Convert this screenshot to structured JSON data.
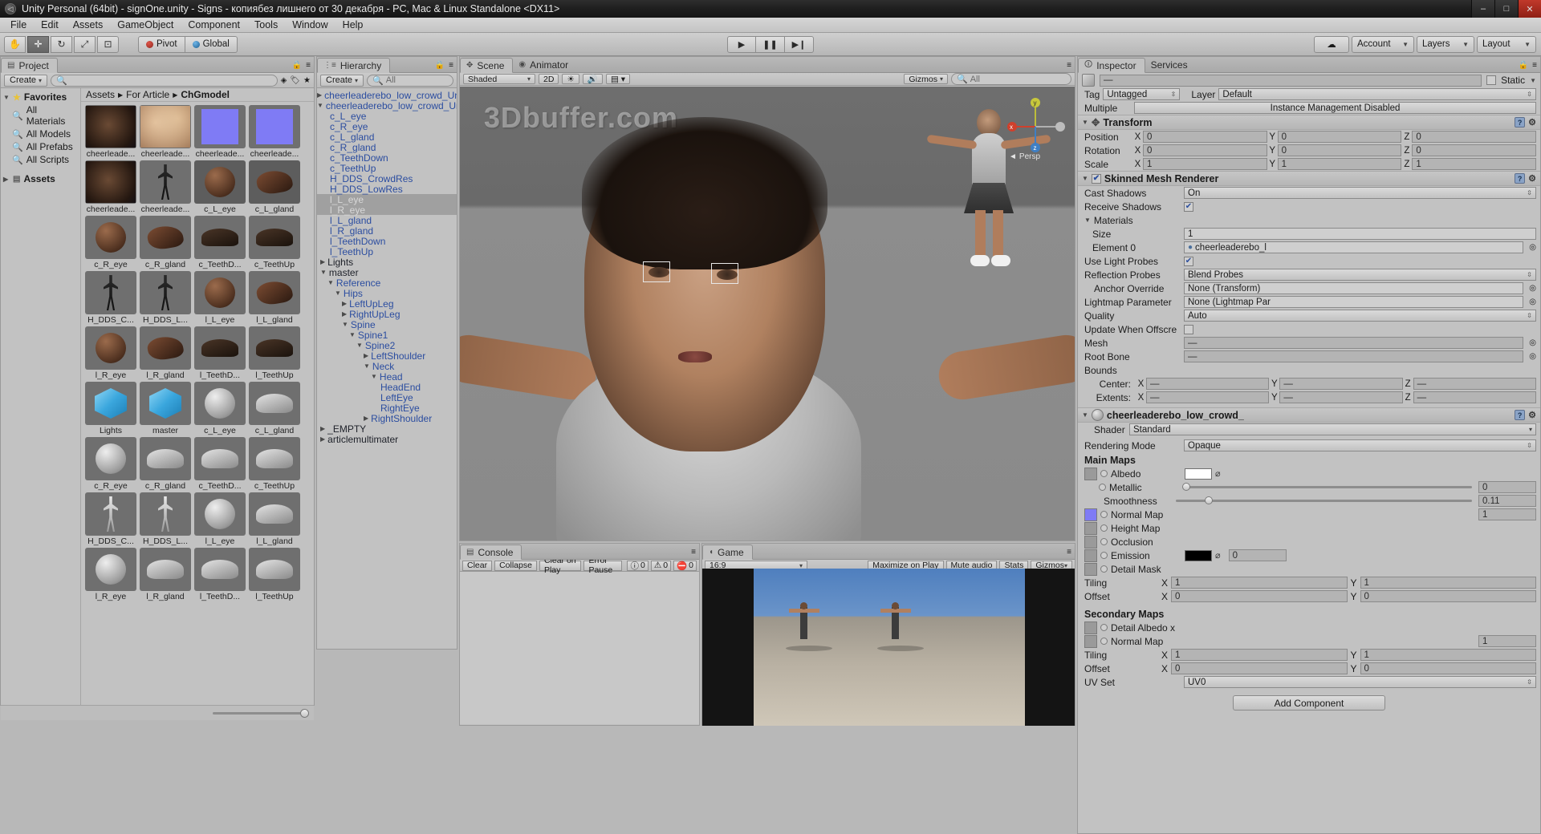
{
  "window": {
    "title": "Unity Personal (64bit) - signOne.unity - Signs - копиябез лишнего от 30 декабря - PC, Mac & Linux Standalone <DX11>",
    "minimize": "–",
    "maximize": "□",
    "close": "✕"
  },
  "menu": [
    "File",
    "Edit",
    "Assets",
    "GameObject",
    "Component",
    "Tools",
    "Window",
    "Help"
  ],
  "toolbar": {
    "tools": [
      "hand-tool",
      "move-tool",
      "rotate-tool",
      "scale-tool",
      "rect-tool"
    ],
    "tool_glyphs": [
      "✋",
      "✛",
      "↻",
      "⤢",
      "⊡"
    ],
    "pivot": "Pivot",
    "global": "Global",
    "play": "▶",
    "pause": "❚❚",
    "step": "▶❙",
    "cloud": "☁",
    "account": "Account",
    "layers": "Layers",
    "layout": "Layout"
  },
  "project": {
    "tab": "Project",
    "create": "Create",
    "search_placeholder": "",
    "favorites_label": "Favorites",
    "favorites": [
      "All Materials",
      "All Models",
      "All Prefabs",
      "All Scripts"
    ],
    "assets_label": "Assets",
    "breadcrumb": [
      "Assets",
      "For Article",
      "ChGmodel"
    ],
    "rows": [
      [
        {
          "name": "cheerleade...",
          "kind": "tex-dark",
          "sel": false
        },
        {
          "name": "cheerleade...",
          "kind": "tex-face",
          "sel": false
        },
        {
          "name": "cheerleade...",
          "kind": "normal",
          "sel": false
        },
        {
          "name": "cheerleade...",
          "kind": "normal",
          "sel": false
        }
      ],
      [
        {
          "name": "cheerleade...",
          "kind": "tex-dark",
          "sel": false
        },
        {
          "name": "cheerleade...",
          "kind": "model-fig",
          "sel": false
        },
        {
          "name": "c_L_eye",
          "kind": "sphere-brown",
          "sel": true
        },
        {
          "name": "c_L_gland",
          "kind": "mesh-brown",
          "sel": true
        }
      ],
      [
        {
          "name": "c_R_eye",
          "kind": "sphere-brown",
          "sel": false
        },
        {
          "name": "c_R_gland",
          "kind": "mesh-brown",
          "sel": false
        },
        {
          "name": "c_TeethD...",
          "kind": "mesh-dark",
          "sel": false
        },
        {
          "name": "c_TeethUp",
          "kind": "mesh-dark",
          "sel": false
        }
      ],
      [
        {
          "name": "H_DDS_C...",
          "kind": "model-fig",
          "sel": false
        },
        {
          "name": "H_DDS_L...",
          "kind": "model-fig",
          "sel": false
        },
        {
          "name": "l_L_eye",
          "kind": "sphere-brown",
          "sel": false
        },
        {
          "name": "l_L_gland",
          "kind": "mesh-brown",
          "sel": false
        }
      ],
      [
        {
          "name": "l_R_eye",
          "kind": "sphere-brown",
          "sel": false
        },
        {
          "name": "l_R_gland",
          "kind": "mesh-brown",
          "sel": false
        },
        {
          "name": "l_TeethD...",
          "kind": "mesh-dark",
          "sel": false
        },
        {
          "name": "l_TeethUp",
          "kind": "mesh-dark",
          "sel": false
        }
      ],
      [
        {
          "name": "Lights",
          "kind": "cube-blue",
          "sel": false
        },
        {
          "name": "master",
          "kind": "cube-blue",
          "sel": false
        },
        {
          "name": "c_L_eye",
          "kind": "sphere-grey",
          "sel": false
        },
        {
          "name": "c_L_gland",
          "kind": "mesh-grey",
          "sel": false
        }
      ],
      [
        {
          "name": "c_R_eye",
          "kind": "sphere-grey",
          "sel": false
        },
        {
          "name": "c_R_gland",
          "kind": "mesh-grey",
          "sel": false
        },
        {
          "name": "c_TeethD...",
          "kind": "mesh-grey",
          "sel": false
        },
        {
          "name": "c_TeethUp",
          "kind": "mesh-grey",
          "sel": false
        }
      ],
      [
        {
          "name": "H_DDS_C...",
          "kind": "model-grey",
          "sel": false
        },
        {
          "name": "H_DDS_L...",
          "kind": "model-grey",
          "sel": false
        },
        {
          "name": "l_L_eye",
          "kind": "sphere-grey",
          "sel": false
        },
        {
          "name": "l_L_gland",
          "kind": "mesh-grey",
          "sel": false
        }
      ],
      [
        {
          "name": "l_R_eye",
          "kind": "sphere-grey",
          "sel": false
        },
        {
          "name": "l_R_gland",
          "kind": "mesh-grey",
          "sel": false
        },
        {
          "name": "l_TeethD...",
          "kind": "mesh-grey",
          "sel": false
        },
        {
          "name": "l_TeethUp",
          "kind": "mesh-grey",
          "sel": false
        }
      ]
    ]
  },
  "hierarchy": {
    "tab": "Hierarchy",
    "create": "Create",
    "search_placeholder": "All",
    "items": [
      {
        "label": "cheerleaderebo_low_crowd_Unity",
        "depth": 0,
        "arrow": "right",
        "style": "prefab",
        "sel": false
      },
      {
        "label": "cheerleaderebo_low_crowd_Unity",
        "depth": 0,
        "arrow": "down",
        "style": "prefab",
        "sel": false
      },
      {
        "label": "c_L_eye",
        "depth": 1,
        "arrow": "none",
        "style": "prefab",
        "sel": false
      },
      {
        "label": "c_R_eye",
        "depth": 1,
        "arrow": "none",
        "style": "prefab",
        "sel": false
      },
      {
        "label": "c_L_gland",
        "depth": 1,
        "arrow": "none",
        "style": "prefab",
        "sel": false
      },
      {
        "label": "c_R_gland",
        "depth": 1,
        "arrow": "none",
        "style": "prefab",
        "sel": false
      },
      {
        "label": "c_TeethDown",
        "depth": 1,
        "arrow": "none",
        "style": "prefab",
        "sel": false
      },
      {
        "label": "c_TeethUp",
        "depth": 1,
        "arrow": "none",
        "style": "prefab",
        "sel": false
      },
      {
        "label": "H_DDS_CrowdRes",
        "depth": 1,
        "arrow": "none",
        "style": "prefab",
        "sel": false
      },
      {
        "label": "H_DDS_LowRes",
        "depth": 1,
        "arrow": "none",
        "style": "prefab",
        "sel": false
      },
      {
        "label": "l_L_eye",
        "depth": 1,
        "arrow": "none",
        "style": "prefab",
        "sel": true
      },
      {
        "label": "l_R_eye",
        "depth": 1,
        "arrow": "none",
        "style": "prefab",
        "sel": true
      },
      {
        "label": "l_L_gland",
        "depth": 1,
        "arrow": "none",
        "style": "prefab",
        "sel": false
      },
      {
        "label": "l_R_gland",
        "depth": 1,
        "arrow": "none",
        "style": "prefab",
        "sel": false
      },
      {
        "label": "l_TeethDown",
        "depth": 1,
        "arrow": "none",
        "style": "prefab",
        "sel": false
      },
      {
        "label": "l_TeethUp",
        "depth": 1,
        "arrow": "none",
        "style": "prefab",
        "sel": false
      },
      {
        "label": "Lights",
        "depth": 0,
        "arrow": "right",
        "style": "plain",
        "sel": false
      },
      {
        "label": "master",
        "depth": 0,
        "arrow": "down",
        "style": "plain",
        "sel": false
      },
      {
        "label": "Reference",
        "depth": 1,
        "arrow": "down",
        "style": "prefab",
        "sel": false
      },
      {
        "label": "Hips",
        "depth": 2,
        "arrow": "down",
        "style": "prefab",
        "sel": false
      },
      {
        "label": "LeftUpLeg",
        "depth": 3,
        "arrow": "right",
        "style": "prefab",
        "sel": false
      },
      {
        "label": "RightUpLeg",
        "depth": 3,
        "arrow": "right",
        "style": "prefab",
        "sel": false
      },
      {
        "label": "Spine",
        "depth": 3,
        "arrow": "down",
        "style": "prefab",
        "sel": false
      },
      {
        "label": "Spine1",
        "depth": 4,
        "arrow": "down",
        "style": "prefab",
        "sel": false
      },
      {
        "label": "Spine2",
        "depth": 5,
        "arrow": "down",
        "style": "prefab",
        "sel": false
      },
      {
        "label": "LeftShoulder",
        "depth": 6,
        "arrow": "right",
        "style": "prefab",
        "sel": false
      },
      {
        "label": "Neck",
        "depth": 6,
        "arrow": "down",
        "style": "prefab",
        "sel": false
      },
      {
        "label": "Head",
        "depth": 7,
        "arrow": "down",
        "style": "prefab",
        "sel": false
      },
      {
        "label": "HeadEnd",
        "depth": 8,
        "arrow": "none",
        "style": "prefab",
        "sel": false
      },
      {
        "label": "LeftEye",
        "depth": 8,
        "arrow": "none",
        "style": "prefab",
        "sel": false
      },
      {
        "label": "RightEye",
        "depth": 8,
        "arrow": "none",
        "style": "prefab",
        "sel": false
      },
      {
        "label": "RightShoulder",
        "depth": 6,
        "arrow": "right",
        "style": "prefab",
        "sel": false
      },
      {
        "label": "_EMPTY",
        "depth": 0,
        "arrow": "right",
        "style": "plain",
        "sel": false
      },
      {
        "label": "articlemultimater",
        "depth": 0,
        "arrow": "right",
        "style": "plain",
        "sel": false
      }
    ]
  },
  "scene": {
    "tab": "Scene",
    "animator_tab": "Animator",
    "shading": "Shaded",
    "mode2d": "2D",
    "gizmos": "Gizmos",
    "search_placeholder": "All",
    "watermark": "3Dbuffer.com",
    "persp_label": "Persp",
    "axis_x": "x",
    "axis_y": "y",
    "axis_z": "z"
  },
  "console": {
    "tab": "Console",
    "buttons": [
      "Clear",
      "Collapse",
      "Clear on Play",
      "Error Pause"
    ],
    "counts": {
      "info": "0",
      "warning": "0",
      "error": "0"
    }
  },
  "game": {
    "tab": "Game",
    "aspect": "16:9",
    "maximize": "Maximize on Play",
    "mute": "Mute audio",
    "stats": "Stats",
    "gizmos": "Gizmos"
  },
  "inspector": {
    "tab": "Inspector",
    "services_tab": "Services",
    "object_name": "—",
    "static_label": "Static",
    "tag_label": "Tag",
    "tag_value": "Untagged",
    "layer_label": "Layer",
    "layer_value": "Default",
    "multiple_label": "Multiple",
    "instance_mgmt": "Instance Management Disabled",
    "transform": {
      "title": "Transform",
      "position_label": "Position",
      "position": {
        "x": "0",
        "y": "0",
        "z": "0"
      },
      "rotation_label": "Rotation",
      "rotation": {
        "x": "0",
        "y": "0",
        "z": "0"
      },
      "scale_label": "Scale",
      "scale": {
        "x": "1",
        "y": "1",
        "z": "1"
      }
    },
    "smr": {
      "title": "Skinned Mesh Renderer",
      "cast_shadows_label": "Cast Shadows",
      "cast_shadows": "On",
      "receive_shadows_label": "Receive Shadows",
      "receive_shadows": true,
      "materials_label": "Materials",
      "size_label": "Size",
      "size": "1",
      "element0_label": "Element 0",
      "element0": "cheerleaderebo_l",
      "light_probes_label": "Use Light Probes",
      "light_probes": true,
      "refl_probes_label": "Reflection Probes",
      "refl_probes": "Blend Probes",
      "anchor_label": "Anchor Override",
      "anchor": "None (Transform)",
      "lightmap_label": "Lightmap Parameter",
      "lightmap": "None (Lightmap Par",
      "quality_label": "Quality",
      "quality": "Auto",
      "update_offscreen_label": "Update When Offscre",
      "update_offscreen": false,
      "mesh_label": "Mesh",
      "mesh": "—",
      "root_bone_label": "Root Bone",
      "root_bone": "—",
      "bounds_label": "Bounds",
      "center_label": "Center:",
      "center": {
        "x": "—",
        "y": "—",
        "z": "—"
      },
      "extents_label": "Extents:",
      "extents": {
        "x": "—",
        "y": "—",
        "z": "—"
      }
    },
    "material": {
      "title": "cheerleaderebo_low_crowd_",
      "shader_label": "Shader",
      "shader": "Standard",
      "rendering_mode_label": "Rendering Mode",
      "rendering_mode": "Opaque",
      "main_maps": "Main Maps",
      "albedo_label": "Albedo",
      "albedo_color": "#ffffff",
      "metallic_label": "Metallic",
      "metallic": "0",
      "metallic_pct": 0,
      "smoothness_label": "Smoothness",
      "smoothness": "0.11",
      "smoothness_pct": 11,
      "normal_map_label": "Normal Map",
      "normal_map": "1",
      "height_map_label": "Height Map",
      "occlusion_label": "Occlusion",
      "emission_label": "Emission",
      "emission_color": "#000000",
      "emission": "0",
      "detail_mask_label": "Detail Mask",
      "tiling_label": "Tiling",
      "tiling": {
        "x": "1",
        "y": "1"
      },
      "offset_label": "Offset",
      "offset": {
        "x": "0",
        "y": "0"
      },
      "secondary_maps": "Secondary Maps",
      "detail_albedo_label": "Detail Albedo x",
      "sec_normal_label": "Normal Map",
      "sec_normal": "1",
      "sec_tiling_label": "Tiling",
      "sec_tiling": {
        "x": "1",
        "y": "1"
      },
      "sec_offset_label": "Offset",
      "sec_offset": {
        "x": "0",
        "y": "0"
      },
      "uv_set_label": "UV Set",
      "uv_set": "UV0"
    },
    "add_component": "Add Component"
  },
  "colors": {
    "chrome": "#c2c2c2",
    "prefab_blue": "#2b4da0",
    "selection": "#a0a0a0",
    "accent_red": "#d0402c",
    "normal_map_blue": "#7f7bf5"
  }
}
